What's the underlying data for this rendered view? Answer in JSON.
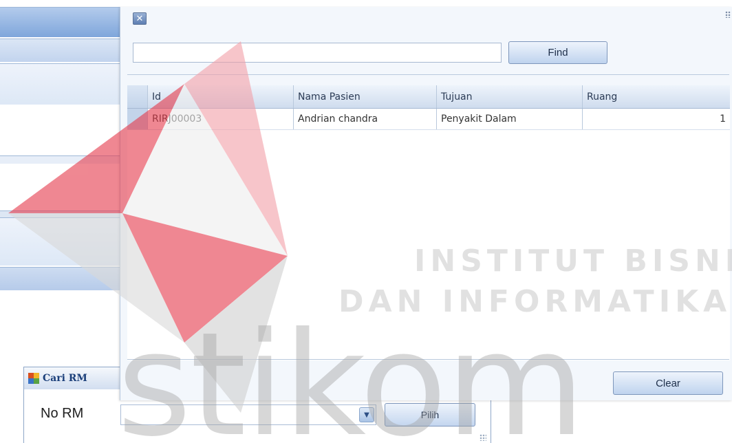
{
  "popup": {
    "search": {
      "value": "",
      "placeholder": ""
    },
    "find_label": "Find",
    "columns": [
      "Id",
      "Nama Pasien",
      "Tujuan",
      "Ruang"
    ],
    "rows": [
      {
        "id": "RIRJ00003",
        "nama_pasien": "Andrian chandra",
        "tujuan": "Penyakit Dalam",
        "ruang": "1"
      }
    ],
    "clear_label": "Clear"
  },
  "cari_window": {
    "title": "Cari RM",
    "field_label": "No RM",
    "combo_value": "",
    "pilih_label": "Pilih"
  },
  "watermark": {
    "line1": "INSTITUT BISNIS",
    "line2": "DAN INFORMATIKA",
    "word": "stikom"
  },
  "icons": {
    "close": "close-icon",
    "dropdown": "chevron-down-icon",
    "app": "app-icon"
  },
  "colors": {
    "accent": "#7fa6db",
    "logo_red": "#e5394a",
    "logo_grey": "#b0b0b0"
  }
}
